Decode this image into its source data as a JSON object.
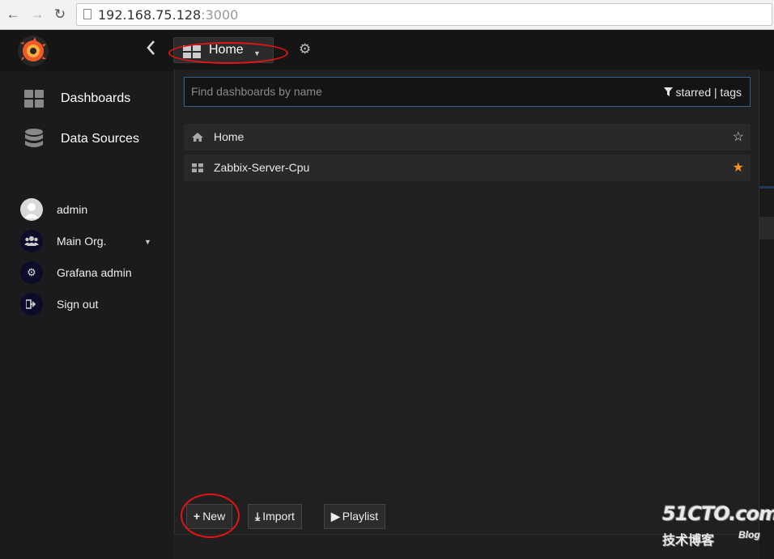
{
  "browser": {
    "url_host": "192.168.75.128",
    "url_port": ":3000"
  },
  "topnav": {
    "dashboard_title": "Home",
    "accent": "#f09a2c"
  },
  "sidebar": {
    "items": [
      {
        "label": "Dashboards",
        "icon": "grid-icon"
      },
      {
        "label": "Data Sources",
        "icon": "database-icon"
      }
    ],
    "user": {
      "name": "admin",
      "org": "Main Org.",
      "grafana_admin": "Grafana admin",
      "sign_out": "Sign out"
    }
  },
  "search": {
    "placeholder": "Find dashboards by name",
    "filter_starred": "starred",
    "filter_sep": "|",
    "filter_tags": "tags"
  },
  "results": [
    {
      "name": "Home",
      "icon": "home-icon",
      "starred": false
    },
    {
      "name": "Zabbix-Server-Cpu",
      "icon": "grid-icon",
      "starred": true
    }
  ],
  "buttons": {
    "new": "New",
    "import": "Import",
    "playlist": "Playlist"
  },
  "watermark": {
    "site": "51CTO.com",
    "sub": "技术博客",
    "blog": "Blog"
  },
  "colors": {
    "star_active": "#f7931e",
    "annotation_red": "#e31414",
    "search_border": "#35638b"
  }
}
